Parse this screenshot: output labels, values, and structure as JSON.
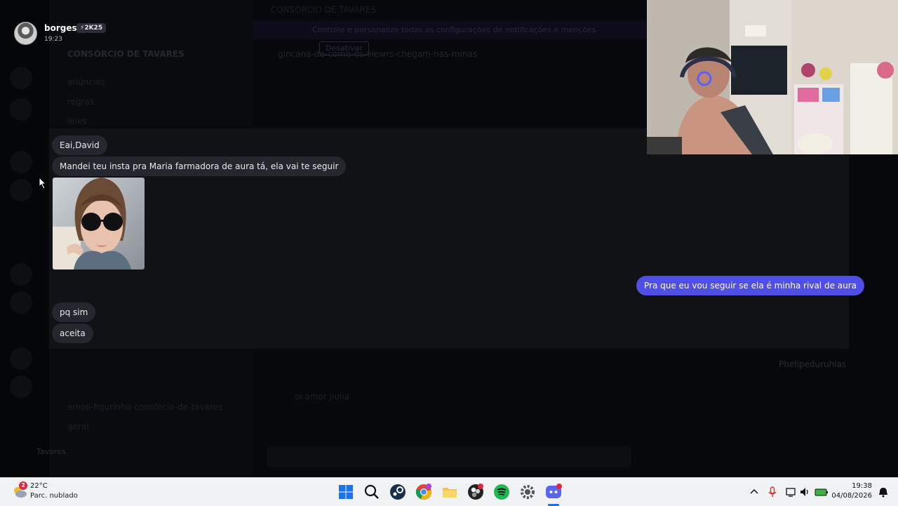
{
  "background": {
    "window_title": "CONSÓRCIO DE TAVARES",
    "notice_text": "Controle e personalize todas as configurações de notificações e menções",
    "notice_button": "Desativar",
    "server_name": "CONSÓRCIO DE TAVARES",
    "channel_name": "gincana-de-como-os-viewrs-chegam-nas-minas",
    "channels": [
      "anúncios",
      "regras",
      "links",
      "emoji-figurinha-consórcio-de-tavares",
      "geral"
    ],
    "sidebar_user": "Tavares",
    "right_member": "Phelipeduruhias",
    "bottom_msg": "oi amor jiulia"
  },
  "overlay": {
    "username": "borges",
    "badge": "⚡2K25",
    "time": "19:23"
  },
  "chat": {
    "messages": [
      {
        "text": "Eai,David",
        "from": "other"
      },
      {
        "text": "Mandei teu insta pra Maria farmadora de aura tá, ela vai te seguir",
        "from": "other"
      },
      {
        "text": "Pra que eu vou seguir se ela é minha rival de aura",
        "from": "me"
      },
      {
        "text": "pq sim",
        "from": "other"
      },
      {
        "text": "aceita",
        "from": "other"
      }
    ]
  },
  "taskbar": {
    "temperature": "22°C",
    "condition": "Parc. nublado",
    "weather_badge": "2",
    "time": "19:38",
    "date": "04/08/2026",
    "apps": [
      "windows-start-icon",
      "search-icon",
      "steam-icon",
      "chrome-icon",
      "file-explorer-icon",
      "obs-icon",
      "spotify-icon",
      "settings-icon",
      "discord-icon"
    ]
  },
  "colors": {
    "accent_bubble": "#4f4ee6",
    "other_bubble": "#24272d",
    "panel": "#101216"
  }
}
